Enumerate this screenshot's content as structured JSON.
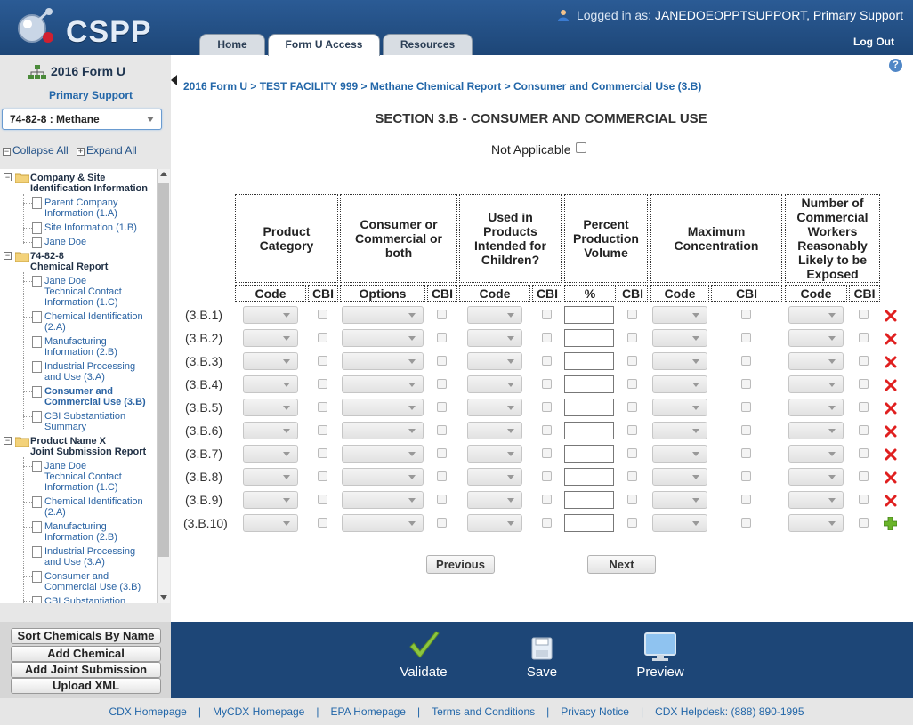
{
  "header": {
    "logo_text": "CSPP",
    "login_label": "Logged in as:",
    "login_user": "JANEDOEOPPTSUPPORT, Primary Support",
    "logout": "Log Out",
    "tabs": [
      {
        "label": "Home",
        "active": false
      },
      {
        "label": "Form U Access",
        "active": true
      },
      {
        "label": "Resources",
        "active": false
      }
    ]
  },
  "sidebar": {
    "form_title": "2016 Form U",
    "form_subtitle": "Primary Support",
    "chemical_select": "74-82-8 : Methane",
    "collapse_all": "Collapse All",
    "expand_all": "Expand All",
    "tree": {
      "company_group": [
        "Company & Site",
        "Identification Information"
      ],
      "company_items": [
        [
          "Parent Company",
          "Information (1.A)"
        ],
        [
          "Site Information (1.B)"
        ],
        [
          "Jane Doe"
        ]
      ],
      "chemical_group": [
        "74-82-8",
        "Chemical Report"
      ],
      "chemical_items": [
        [
          "Jane Doe",
          "Technical Contact",
          "Information (1.C)"
        ],
        [
          "Chemical Identification",
          "(2.A)"
        ],
        [
          "Manufacturing",
          "Information (2.B)"
        ],
        [
          "Industrial Processing",
          "and Use (3.A)"
        ],
        [
          "Consumer and",
          "Commercial Use (3.B)"
        ],
        [
          "CBI Substantiation",
          "Summary"
        ]
      ],
      "product_group": [
        "Product Name X",
        "Joint Submission Report"
      ],
      "product_items": [
        [
          "Jane Doe",
          "Technical Contact",
          "Information (1.C)"
        ],
        [
          "Chemical Identification",
          "(2.A)"
        ],
        [
          "Manufacturing",
          "Information (2.B)"
        ],
        [
          "Industrial Processing",
          "and Use (3.A)"
        ],
        [
          "Consumer and",
          "Commercial Use (3.B)"
        ],
        [
          "CBI Substantiation"
        ]
      ]
    },
    "buttons": [
      "Sort Chemicals By Name",
      "Add Chemical",
      "Add Joint Submission",
      "Upload XML"
    ]
  },
  "breadcrumb": [
    "2016 Form U",
    "TEST FACILITY 999",
    "Methane Chemical Report",
    "Consumer and Commercial Use (3.B)"
  ],
  "breadcrumb_sep": " > ",
  "section_title": "SECTION 3.B - CONSUMER AND COMMERCIAL USE",
  "not_applicable": "Not Applicable",
  "table": {
    "column_groups": [
      "Product Category",
      "Consumer or Commercial or both",
      "Used in Products Intended for Children?",
      "Percent Production Volume",
      "Maximum Concentration",
      "Number of Commercial Workers Reasonably Likely to be Exposed"
    ],
    "sub_headers": [
      "Code",
      "CBI",
      "Options",
      "CBI",
      "Code",
      "CBI",
      "%",
      "CBI",
      "Code",
      "CBI",
      "Code",
      "CBI"
    ],
    "rows": [
      "(3.B.1)",
      "(3.B.2)",
      "(3.B.3)",
      "(3.B.4)",
      "(3.B.5)",
      "(3.B.6)",
      "(3.B.7)",
      "(3.B.8)",
      "(3.B.9)",
      "(3.B.10)"
    ]
  },
  "nav": {
    "previous": "Previous",
    "next": "Next"
  },
  "actions": {
    "validate": "Validate",
    "save": "Save",
    "preview": "Preview"
  },
  "footer": {
    "links": [
      "CDX Homepage",
      "MyCDX Homepage",
      "EPA Homepage",
      "Terms and Conditions",
      "Privacy Notice",
      "CDX Helpdesk: (888) 890-1995"
    ],
    "separator": "|"
  },
  "colors": {
    "header_blue": "#1d4677",
    "link_blue": "#2266a8",
    "delete_red": "#e02020",
    "add_green": "#6ab42a",
    "validate_green": "#8cc63f"
  }
}
